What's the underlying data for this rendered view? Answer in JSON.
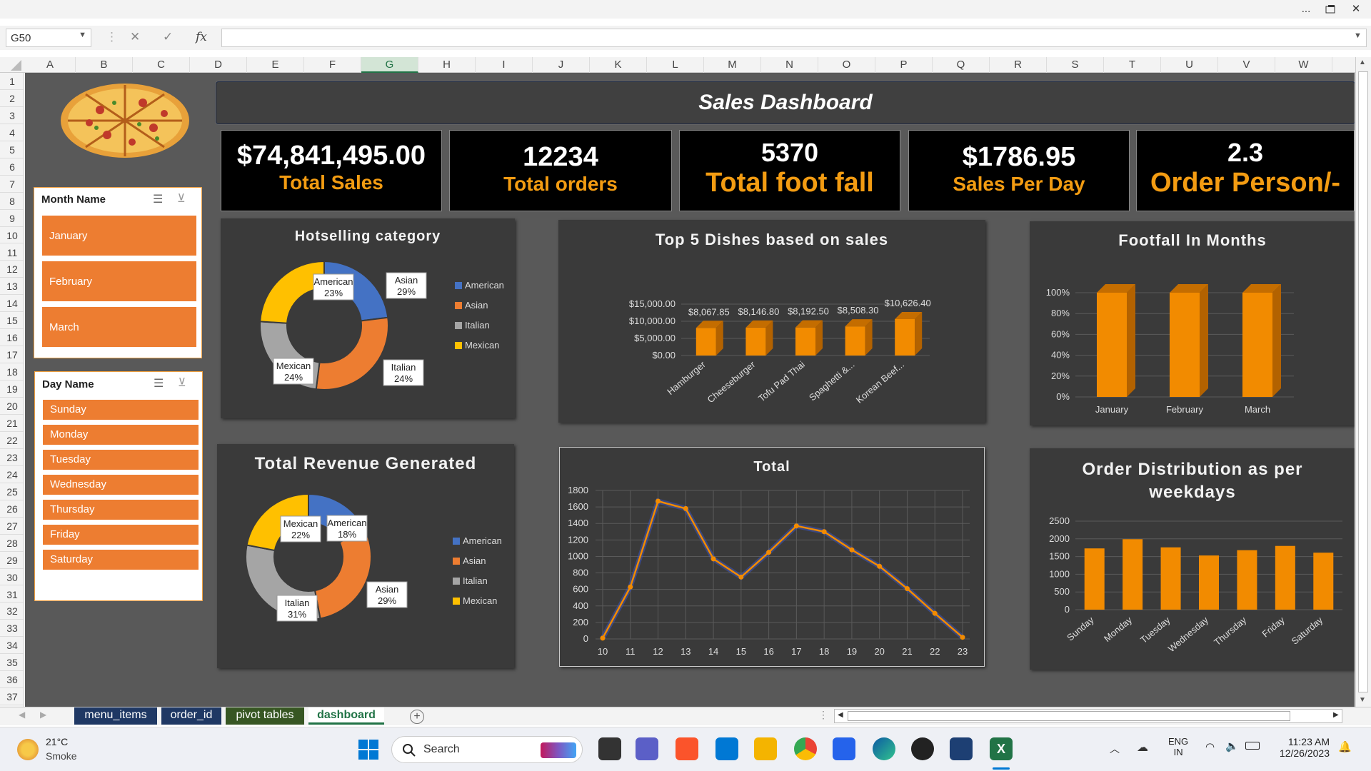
{
  "window": {
    "more_icon": "...",
    "restore_icon": "restore-icon",
    "close_icon": "✕"
  },
  "formula_bar": {
    "name_box": "G50",
    "fx": "fx",
    "cancel": "✕",
    "enter": "✓",
    "value": ""
  },
  "columns": [
    "A",
    "B",
    "C",
    "D",
    "E",
    "F",
    "G",
    "H",
    "I",
    "J",
    "K",
    "L",
    "M",
    "N",
    "O",
    "P",
    "Q",
    "R",
    "S",
    "T",
    "U",
    "V",
    "W"
  ],
  "selected_column": "G",
  "rows": [
    "1",
    "2",
    "3",
    "4",
    "5",
    "6",
    "7",
    "8",
    "9",
    "10",
    "11",
    "12",
    "13",
    "14",
    "15",
    "16",
    "17",
    "18",
    "19",
    "20",
    "21",
    "22",
    "23",
    "24",
    "25",
    "26",
    "27",
    "28",
    "29",
    "30",
    "31",
    "32",
    "33",
    "34",
    "35",
    "36",
    "37"
  ],
  "dashboard": {
    "title": "Sales Dashboard",
    "kpis": [
      {
        "value": "$74,841,495.00",
        "label": "Total Sales"
      },
      {
        "value": "12234",
        "label": "Total orders"
      },
      {
        "value": "5370",
        "label": "Total foot fall"
      },
      {
        "value": "$1786.95",
        "label": "Sales Per Day"
      },
      {
        "value": "2.3",
        "label": "Order Person/-"
      }
    ]
  },
  "slicers": {
    "month": {
      "header": "Month Name",
      "items": [
        "January",
        "February",
        "March"
      ]
    },
    "day": {
      "header": "Day Name",
      "items": [
        "Sunday",
        "Monday",
        "Tuesday",
        "Wednesday",
        "Thursday",
        "Friday",
        "Saturday"
      ]
    }
  },
  "colors": {
    "accent": "#f28b00",
    "slicer": "#ed7d31",
    "american": "#4472c4",
    "asian": "#ed7d31",
    "italian": "#a5a5a5",
    "mexican": "#ffc000",
    "panel": "#3a3a3a",
    "sheet_bg": "#595959"
  },
  "chart_data": [
    {
      "type": "pie",
      "title": "Hotselling category",
      "labels": [
        "American",
        "Asian",
        "Italian",
        "Mexican"
      ],
      "values": [
        23,
        29,
        24,
        24
      ],
      "data_labels": [
        "American\n23%",
        "Asian\n29%",
        "Italian\n24%",
        "Mexican\n24%"
      ],
      "legend": [
        "American",
        "Asian",
        "Italian",
        "Mexican"
      ],
      "legend_position": "right"
    },
    {
      "type": "bar",
      "title": "Top 5 Dishes based on sales",
      "categories": [
        "Hamburger",
        "Cheeseburger",
        "Tofu Pad Thai",
        "Spaghetti &...",
        "Korean Beef..."
      ],
      "values": [
        8067.85,
        8146.8,
        8192.5,
        8508.3,
        10626.4
      ],
      "data_labels": [
        "$8,067.85",
        "$8,146.80",
        "$8,192.50",
        "$8,508.30",
        "$10,626.40"
      ],
      "yticks": [
        "$0.00",
        "$5,000.00",
        "$10,000.00",
        "$15,000.00"
      ],
      "ylim": [
        0,
        15000
      ]
    },
    {
      "type": "bar",
      "title": "Footfall In Months",
      "categories": [
        "January",
        "February",
        "March"
      ],
      "values": [
        100,
        100,
        100
      ],
      "yticks": [
        "0%",
        "20%",
        "40%",
        "60%",
        "80%",
        "100%"
      ],
      "ylim": [
        0,
        100
      ]
    },
    {
      "type": "pie",
      "title": "Total Revenue Generated",
      "labels": [
        "American",
        "Asian",
        "Italian",
        "Mexican"
      ],
      "values": [
        18,
        29,
        31,
        22
      ],
      "data_labels": [
        "American\n18%",
        "Asian\n29%",
        "Italian\n31%",
        "Mexican\n22%"
      ],
      "legend": [
        "American",
        "Asian",
        "Italian",
        "Mexican"
      ],
      "legend_position": "right"
    },
    {
      "type": "line",
      "title": "Total",
      "x": [
        "10",
        "11",
        "12",
        "13",
        "14",
        "15",
        "16",
        "17",
        "18",
        "19",
        "20",
        "21",
        "22",
        "23"
      ],
      "values": [
        10,
        630,
        1670,
        1580,
        970,
        750,
        1050,
        1370,
        1300,
        1080,
        880,
        610,
        310,
        20
      ],
      "yticks": [
        "0",
        "200",
        "400",
        "600",
        "800",
        "1000",
        "1200",
        "1400",
        "1600",
        "1800"
      ],
      "ylim": [
        0,
        1800
      ]
    },
    {
      "type": "bar",
      "title": "Order Distribution as per weekdays",
      "categories": [
        "Sunday",
        "Monday",
        "Tuesday",
        "Wednesday",
        "Thursday",
        "Friday",
        "Saturday"
      ],
      "values": [
        1730,
        1990,
        1760,
        1530,
        1680,
        1800,
        1610
      ],
      "yticks": [
        "0",
        "500",
        "1000",
        "1500",
        "2000",
        "2500"
      ],
      "ylim": [
        0,
        2500
      ]
    }
  ],
  "sheet_tabs": [
    {
      "label": "menu_items",
      "color": "#1f3864"
    },
    {
      "label": "order_id",
      "color": "#1f3864"
    },
    {
      "label": "pivot tables",
      "color": "#375623"
    },
    {
      "label": "dashboard",
      "color": "#f3f3f3",
      "active": true
    }
  ],
  "taskbar": {
    "weather_temp": "21°C",
    "weather_desc": "Smoke",
    "search": "Search",
    "lang1": "ENG",
    "lang2": "IN",
    "time": "11:23 AM",
    "date": "12/26/2023"
  }
}
